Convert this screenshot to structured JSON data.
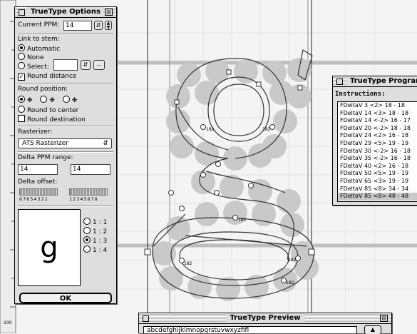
{
  "options": {
    "title": "TrueType Options",
    "ppm_label": "Current PPM:",
    "ppm_value": "14",
    "link_label": "Link to stem:",
    "link_automatic": "Automatic",
    "link_none": "None",
    "link_select": "Select:",
    "link_more": "...",
    "round_distance": "Round distance",
    "round_position_label": "Round position:",
    "round_to_center": "Round to center",
    "round_destination": "Round destination",
    "rasterizer_label": "Rasterizer:",
    "rasterizer_value": "ATS Rasterizer",
    "delta_range_label": "Delta PPM range:",
    "delta_from": "14",
    "delta_to": "14",
    "delta_offset_label": "Delta offset:",
    "offset_left_digits": "87654321",
    "offset_right_digits": "12345678",
    "preview_glyph": "g",
    "ratio_1": "1 : 1",
    "ratio_2": "1 : 2",
    "ratio_3": "1 : 3",
    "ratio_4": "1 : 4",
    "ok": "OK"
  },
  "program": {
    "title": "TrueType Program",
    "instructions_label": "Instructions:",
    "instructions": [
      "FDeltaV 3 <2> 18 - 18",
      "FDeltaV 14 <3> 18 - 18",
      "FDeltaV 14 <-2> 16 - 17",
      "FDeltaV 20 <-2> 18 - 18",
      "FDeltaV 24 <2> 16 - 18",
      "FDeltaV 29 <5> 19 - 19",
      "FDeltaV 30 <-2> 16 - 18",
      "FDeltaV 35 <-2> 16 - 18",
      "FDeltaV 40 <2> 16 - 18",
      "FDeltaV 50 <5> 19 - 19",
      "FDeltaV 65 <3> 19 - 19",
      "FDeltaV 85 <8> 34 - 34",
      "FDeltaV 85 <8> 48 - 48"
    ]
  },
  "preview": {
    "title": "TrueType Preview",
    "text": "abcdefghijklmnopqrstuvwxyzfifl"
  },
  "editor": {
    "ruler_label": "-100",
    "point_labels": [
      "182",
      "182",
      "182",
      "182",
      "182",
      "182"
    ]
  },
  "colors": {
    "pixel_fill": "#c9c9c9",
    "guideline": "#a8a8a8",
    "window_face": "#dedede"
  }
}
